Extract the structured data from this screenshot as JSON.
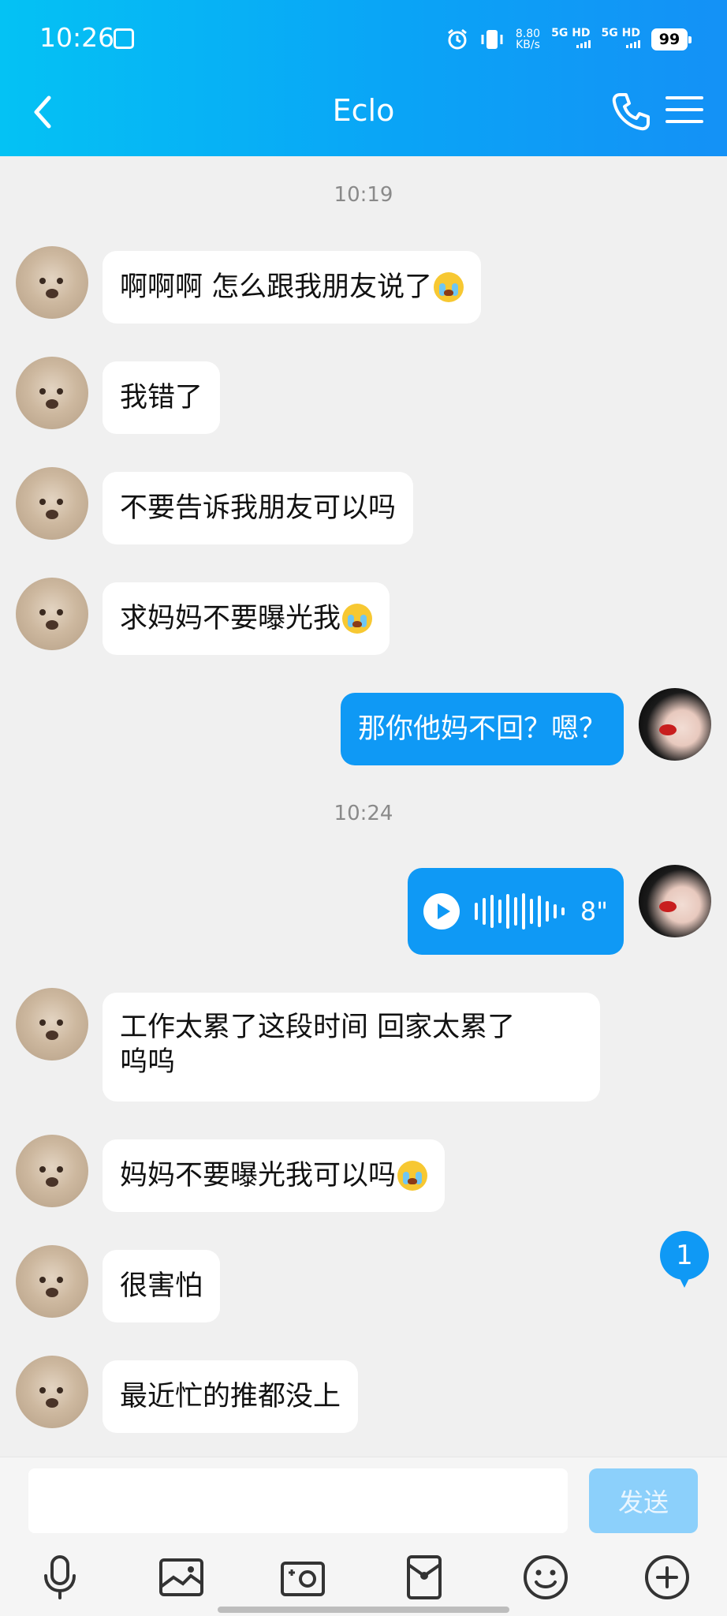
{
  "status_bar": {
    "time": "10:26",
    "speed_value": "8.80",
    "speed_unit": "KB/s",
    "net1": "5G HD",
    "net2": "5G HD",
    "battery": "99"
  },
  "header": {
    "title": "Eclo",
    "accent_color": "#0aa4f6"
  },
  "messages": [
    {
      "type": "timestamp",
      "text": "10:19"
    },
    {
      "type": "incoming",
      "text": "啊啊啊 怎么跟我朋友说了",
      "emoji": "crying-face"
    },
    {
      "type": "incoming",
      "text": "我错了"
    },
    {
      "type": "incoming",
      "text": "不要告诉我朋友可以吗"
    },
    {
      "type": "incoming",
      "text": "求妈妈不要曝光我",
      "emoji": "crying-face"
    },
    {
      "type": "outgoing",
      "text": "那你他妈不回？嗯？"
    },
    {
      "type": "timestamp",
      "text": "10:24"
    },
    {
      "type": "outgoing-voice",
      "duration": "8\""
    },
    {
      "type": "incoming",
      "line1": "工作太累了这段时间 回家太累了",
      "line2": "呜呜"
    },
    {
      "type": "incoming",
      "text": "妈妈不要曝光我可以吗",
      "emoji": "crying-face"
    },
    {
      "type": "incoming",
      "text": "很害怕"
    },
    {
      "type": "incoming",
      "text": "最近忙的推都没上"
    }
  ],
  "unread_badge": "1",
  "composer": {
    "input_value": "",
    "send_label": "发送"
  },
  "toolbar_icons": [
    "microphone-icon",
    "image-icon",
    "camera-icon",
    "red-packet-icon",
    "emoji-icon",
    "plus-icon"
  ]
}
